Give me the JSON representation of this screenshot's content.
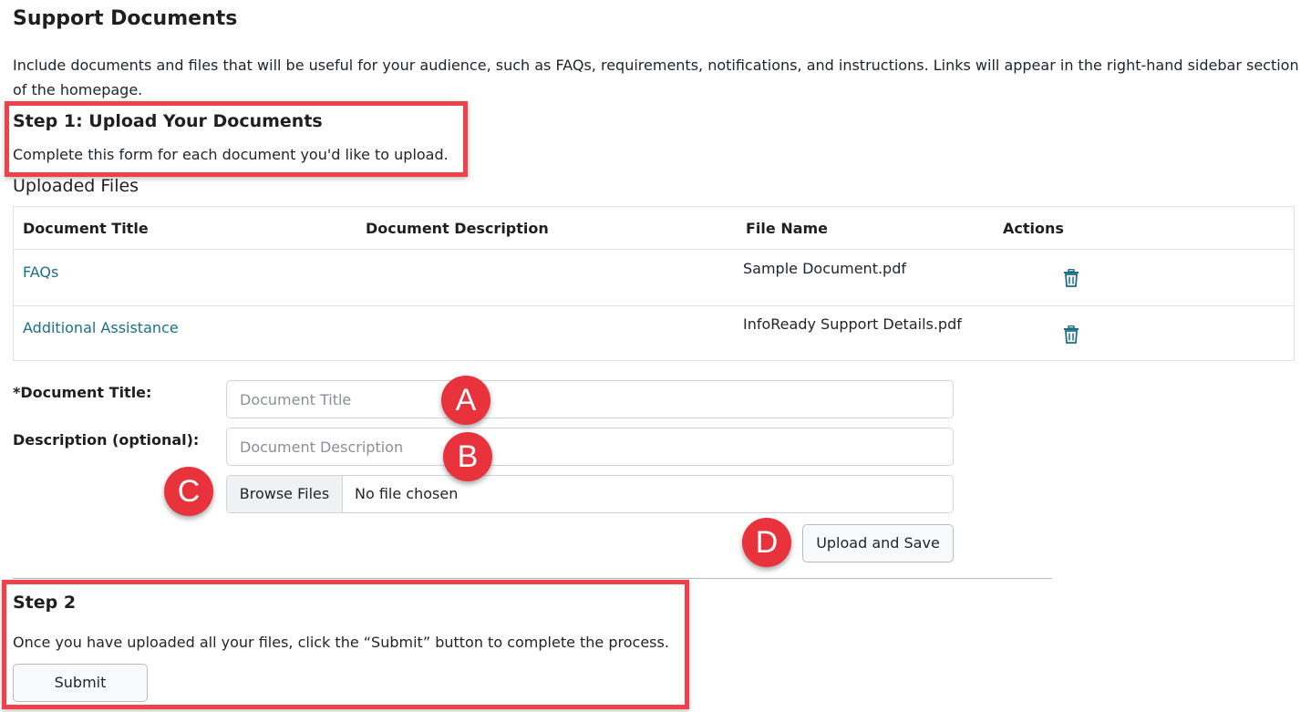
{
  "page": {
    "title": "Support Documents",
    "intro": "Include documents and files that will be useful for your audience, such as FAQs, requirements, notifications, and instructions. Links will appear in the right-hand sidebar section of the homepage."
  },
  "step1": {
    "title": "Step 1: Upload Your Documents",
    "description": "Complete this form for each document you'd like to upload."
  },
  "uploaded_files": {
    "label": "Uploaded Files",
    "columns": [
      "Document Title",
      "Document Description",
      "File Name",
      "Actions"
    ],
    "rows": [
      {
        "title": "FAQs",
        "description": "",
        "file_name": "Sample Document.pdf",
        "action_icon": "trash-icon"
      },
      {
        "title": "Additional Assistance",
        "description": "",
        "file_name": "InfoReady Support Details.pdf",
        "action_icon": "trash-icon"
      }
    ]
  },
  "form": {
    "title_label": "*Document Title:",
    "title_placeholder": "Document Title",
    "description_label": "Description (optional):",
    "description_placeholder": "Document Description",
    "browse_label": "Browse Files",
    "file_status": "No file chosen",
    "upload_label": "Upload and Save"
  },
  "step2": {
    "title": "Step 2",
    "description": "Once you have uploaded all your files, click the “Submit” button to complete the process.",
    "submit_label": "Submit"
  },
  "annotations": {
    "a": "A",
    "b": "B",
    "c": "C",
    "d": "D"
  },
  "colors": {
    "link": "#1a6f86",
    "highlight": "#f0404a",
    "badge": "#e8333d"
  }
}
